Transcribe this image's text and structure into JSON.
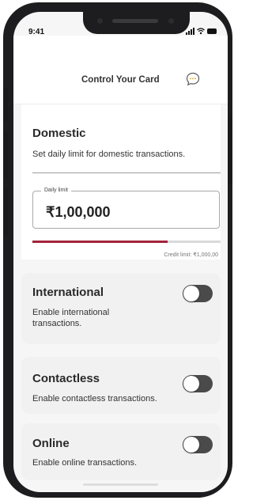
{
  "status_bar": {
    "time": "9:41",
    "icons": [
      "cellular-signal-icon",
      "wifi-icon",
      "battery-icon"
    ]
  },
  "header": {
    "title": "Control Your Card",
    "chat_icon": "chat-bubble-icon"
  },
  "domestic": {
    "title": "Domestic",
    "description": "Set daily limit for domestic transactions.",
    "limit_label": "Daily limit",
    "limit_value": "₹1,00,000",
    "progress_fraction": 0.72,
    "credit_limit": "Credit limit: ₹1,000,00"
  },
  "international": {
    "title": "International",
    "description": "Enable international transactions.",
    "enabled": false
  },
  "contactless": {
    "title": "Contactless",
    "description": "Enable contactless transactions.",
    "enabled": false
  },
  "online": {
    "title": "Online",
    "description": "Enable online transactions.",
    "enabled": false
  },
  "colors": {
    "accent": "#a3233a",
    "toggle_off": "#4a4a4a",
    "background": "#f6f6f6"
  }
}
